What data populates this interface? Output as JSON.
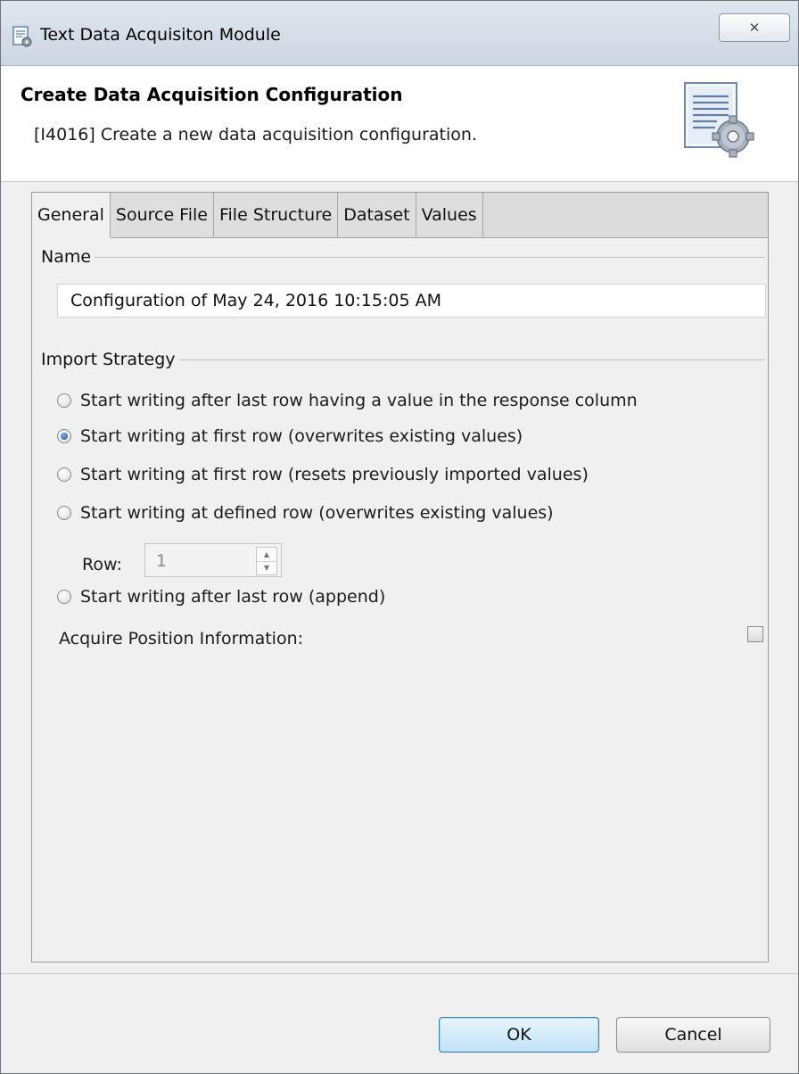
{
  "window": {
    "title": "Text Data Acquisiton Module",
    "icon": "settings-document-icon",
    "close_symbol": "✕"
  },
  "header": {
    "title": "Create Data Acquisition Configuration",
    "message": "[I4016] Create a new data acquisition configuration.",
    "icon": "document-gear-icon"
  },
  "tabs": [
    {
      "label": "General",
      "active": true
    },
    {
      "label": "Source File",
      "active": false
    },
    {
      "label": "File Structure",
      "active": false
    },
    {
      "label": "Dataset",
      "active": false
    },
    {
      "label": "Values",
      "active": false
    }
  ],
  "general": {
    "name_group_label": "Name",
    "name_value": "Configuration of May 24, 2016 10:15:05 AM",
    "import_group_label": "Import Strategy",
    "strategies": [
      {
        "label": "Start writing after last row having a value in the response column",
        "checked": false
      },
      {
        "label": "Start writing at first row (overwrites existing values)",
        "checked": true
      },
      {
        "label": "Start writing at first row (resets previously imported values)",
        "checked": false
      },
      {
        "label": "Start writing at defined row (overwrites existing values)",
        "checked": false
      },
      {
        "label": "Start writing after last row (append)",
        "checked": false
      }
    ],
    "row_label": "Row:",
    "row_value": "1",
    "acquire_label": "Acquire Position Information:",
    "acquire_checked": false
  },
  "buttons": {
    "ok": "OK",
    "cancel": "Cancel"
  },
  "colors": {
    "default_button_border": "#3c7fb1",
    "radio_selected": "#1f4e86"
  }
}
